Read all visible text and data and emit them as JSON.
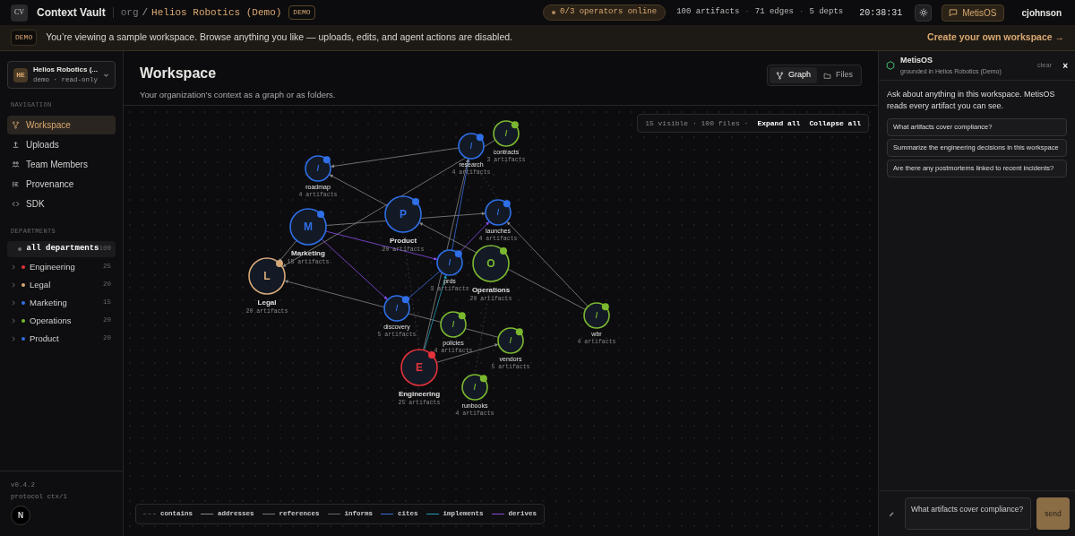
{
  "header": {
    "logo": "CV",
    "app_name": "Context Vault",
    "breadcrumb_org": "org",
    "breadcrumb_sep": "/",
    "workspace": "Helios Robotics (Demo)",
    "badge": "DEMO",
    "operators": "0/3 operators online",
    "stats": [
      "100 artifacts",
      "71 edges",
      "5 depts"
    ],
    "stat_sep": "·",
    "clock": "20:38:31",
    "assistant_button": "MetisOS",
    "user": "cjohnson"
  },
  "banner": {
    "badge": "DEMO",
    "message": "You’re viewing a sample workspace. Browse anything you like — uploads, edits, and agent actions are disabled.",
    "link": "Create your own workspace →"
  },
  "sidebar": {
    "org": {
      "initials": "HE",
      "name": "Helios Robotics (...",
      "meta": "demo · read-only"
    },
    "navigation_heading": "NAVIGATION",
    "items": [
      {
        "label": "Workspace",
        "kind": "graph",
        "selected": true
      },
      {
        "label": "Uploads",
        "kind": "upload",
        "selected": false
      },
      {
        "label": "Team Members",
        "kind": "team",
        "selected": false
      },
      {
        "label": "Provenance",
        "kind": "provenance",
        "selected": false
      },
      {
        "label": "SDK",
        "kind": "code",
        "selected": false
      }
    ],
    "departments_heading": "DEPARTMENTS",
    "departments": [
      {
        "name": "all departments",
        "count": "100",
        "color": "#6b6b6b",
        "selected": true
      },
      {
        "name": "Engineering",
        "count": "25",
        "color": "#e5323b",
        "selected": false
      },
      {
        "name": "Legal",
        "count": "20",
        "color": "#d6a878",
        "selected": false
      },
      {
        "name": "Marketing",
        "count": "15",
        "color": "#2f6fe8",
        "selected": false
      },
      {
        "name": "Operations",
        "count": "20",
        "color": "#7cb82f",
        "selected": false
      },
      {
        "name": "Product",
        "count": "20",
        "color": "#2f6fe8",
        "selected": false
      }
    ],
    "version": "v0.4.2",
    "protocol": "protocol ctx/1",
    "avatar": "N"
  },
  "main": {
    "title": "Workspace",
    "subtitle": "Your organization's context as a graph or as folders.",
    "view_tabs": [
      {
        "label": "Graph",
        "kind": "graph",
        "selected": true
      },
      {
        "label": "Files",
        "kind": "folder",
        "selected": false
      }
    ],
    "graph": {
      "summary": "15 visible · 100 files ·",
      "expand": "Expand all",
      "collapse": "Collapse all",
      "nodes": [
        {
          "label": "roadmap",
          "count": "4 artifacts",
          "glyph": "/",
          "kind": "folder",
          "color": "#2f6fe8"
        },
        {
          "label": "research",
          "count": "4 artifacts",
          "glyph": "/",
          "kind": "folder",
          "color": "#2f6fe8"
        },
        {
          "label": "contracts",
          "count": "3 artifacts",
          "glyph": "/",
          "kind": "folder",
          "color": "#7cb82f"
        },
        {
          "label": "Product",
          "count": "20 artifacts",
          "glyph": "P",
          "kind": "department",
          "color": "#2f6fe8"
        },
        {
          "label": "Marketing",
          "count": "15 artifacts",
          "glyph": "M",
          "kind": "department",
          "color": "#2f6fe8"
        },
        {
          "label": "launches",
          "count": "4 artifacts",
          "glyph": "/",
          "kind": "folder",
          "color": "#2f6fe8"
        },
        {
          "label": "Legal",
          "count": "20 artifacts",
          "glyph": "L",
          "kind": "department",
          "color": "#d6a878"
        },
        {
          "label": "prds",
          "count": "3 artifacts",
          "glyph": "/",
          "kind": "folder",
          "color": "#2f6fe8"
        },
        {
          "label": "Operations",
          "count": "20 artifacts",
          "glyph": "O",
          "kind": "department",
          "color": "#7cb82f"
        },
        {
          "label": "discovery",
          "count": "5 artifacts",
          "glyph": "/",
          "kind": "folder",
          "color": "#2f6fe8"
        },
        {
          "label": "policies",
          "count": "4 artifacts",
          "glyph": "/",
          "kind": "folder",
          "color": "#7cb82f"
        },
        {
          "label": "Engineering",
          "count": "25 artifacts",
          "glyph": "E",
          "kind": "department",
          "color": "#e5323b"
        },
        {
          "label": "vendors",
          "count": "5 artifacts",
          "glyph": "/",
          "kind": "folder",
          "color": "#7cb82f"
        },
        {
          "label": "runbooks",
          "count": "4 artifacts",
          "glyph": "/",
          "kind": "folder",
          "color": "#7cb82f"
        },
        {
          "label": "wbr",
          "count": "4 artifacts",
          "glyph": "/",
          "kind": "folder",
          "color": "#7cb82f"
        }
      ],
      "legend": [
        {
          "label": "contains",
          "kind": "dashed",
          "color": "#4a4a4a"
        },
        {
          "label": "addresses",
          "kind": "solid",
          "color": "#8a8a8a"
        },
        {
          "label": "references",
          "kind": "solid",
          "color": "#777777"
        },
        {
          "label": "informs",
          "kind": "solid",
          "color": "#666666"
        },
        {
          "label": "cites",
          "kind": "solid",
          "color": "#3b6fe0"
        },
        {
          "label": "implements",
          "kind": "solid",
          "color": "#1f9bb5"
        },
        {
          "label": "derives",
          "kind": "solid",
          "color": "#8a4de8"
        }
      ]
    }
  },
  "assistant": {
    "name": "MetisOS",
    "context": "grounded in Helios Robotics (Demo)",
    "clear": "clear",
    "close": "×",
    "intro": "Ask about anything in this workspace. MetisOS reads every artifact you can see.",
    "suggestions": [
      "What artifacts cover compliance?",
      "Summarize the engineering decisions in this workspace",
      "Are there any postmortems linked to recent incidents?"
    ],
    "input": "What artifacts cover compliance?",
    "send": "send"
  }
}
